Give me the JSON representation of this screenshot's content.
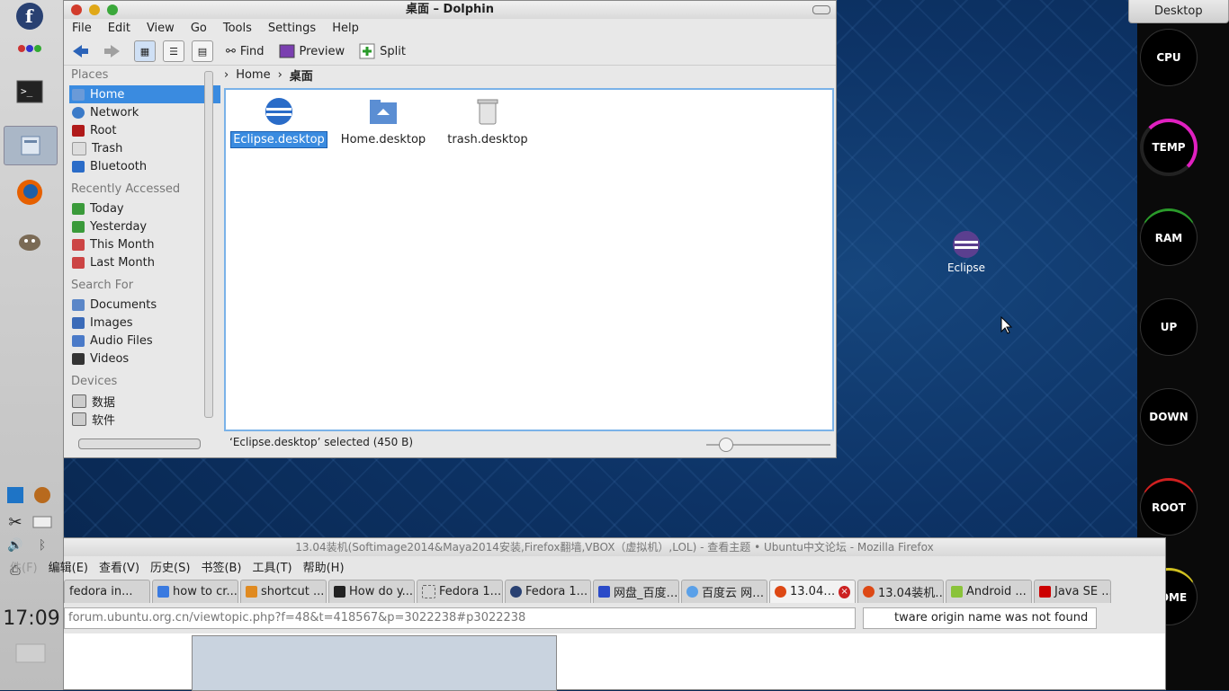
{
  "desktop": {
    "tab_label": "Desktop",
    "eclipse_icon_label": "Eclipse"
  },
  "left_panel": {
    "clock": "17:09"
  },
  "gauges": [
    "CPU",
    "TEMP",
    "RAM",
    "UP",
    "DOWN",
    "ROOT",
    "HOME"
  ],
  "dolphin": {
    "title": "桌面 – Dolphin",
    "menu": [
      "File",
      "Edit",
      "View",
      "Go",
      "Tools",
      "Settings",
      "Help"
    ],
    "toolbar": {
      "find": "Find",
      "preview": "Preview",
      "split": "Split"
    },
    "places": {
      "header": "Places",
      "items": [
        "Home",
        "Network",
        "Root",
        "Trash",
        "Bluetooth"
      ],
      "recent_header": "Recently Accessed",
      "recent": [
        "Today",
        "Yesterday",
        "This Month",
        "Last Month"
      ],
      "search_header": "Search For",
      "search": [
        "Documents",
        "Images",
        "Audio Files",
        "Videos"
      ],
      "devices_header": "Devices",
      "devices": [
        "数据",
        "软件"
      ]
    },
    "breadcrumb": [
      "Home",
      "桌面"
    ],
    "files": [
      "Eclipse.desktop",
      "Home.desktop",
      "trash.desktop"
    ],
    "status": "‘Eclipse.desktop’   selected (450 B)"
  },
  "firefox": {
    "title": "13.04装机(Softimage2014&Maya2014安装,Firefox翻墙,VBOX（虚拟机）,LOL) - 查看主题 • Ubuntu中文论坛 - Mozilla Firefox",
    "menu": [
      "件(F)",
      "编辑(E)",
      "查看(V)",
      "历史(S)",
      "书签(B)",
      "工具(T)",
      "帮助(H)"
    ],
    "tabs": [
      "fedora in...",
      "how to cr...",
      "shortcut ...",
      "How do y...",
      "Fedora 1...",
      "Fedora 1...",
      "网盘_百度…",
      "百度云 网…",
      "13.04…",
      "13.04装机…",
      "Android ...",
      "Java SE ..."
    ],
    "url": "forum.ubuntu.org.cn/viewtopic.php?f=48&t=418567&p=3022238#p3022238",
    "search": "tware origin name was not found"
  }
}
